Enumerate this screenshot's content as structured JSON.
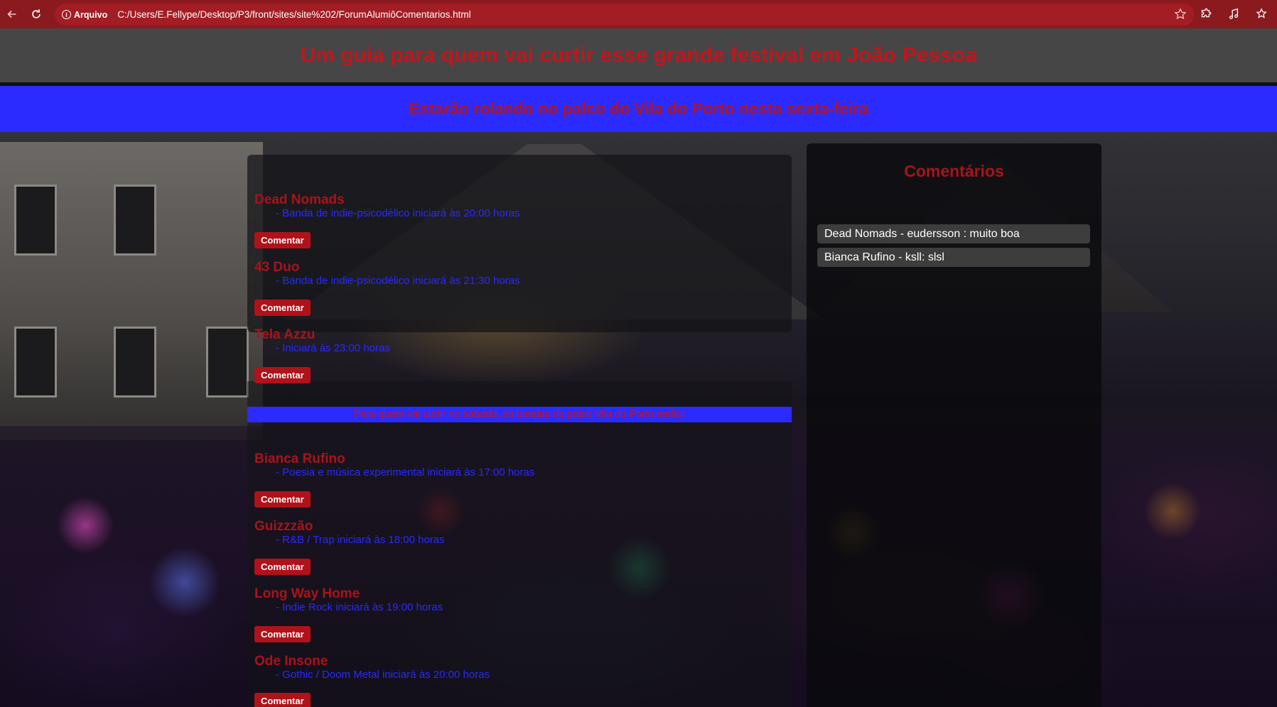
{
  "browser": {
    "info_label": "Arquivo",
    "url": "C:/Users/E.Fellype/Desktop/P3/front/sites/site%202/ForumAlumiôComentarios.html"
  },
  "page": {
    "title": "Um guia para quem vai curtir esse grande festival em João Pessoa",
    "friday_heading": "Estarão rolando no palco do Vila do Porto nesta sexta-feira",
    "saturday_heading": "Para quem vai curtir no sábado, as bandas do palco Vila do Porto serão:",
    "comment_button_label": "Comentar"
  },
  "friday_bands": [
    {
      "name": "Dead Nomads",
      "desc": "Banda de indie-psicodélico iniciará às 20:00 horas"
    },
    {
      "name": "43 Duo",
      "desc": "Banda de indie-psicodélico iniciará às 21:30 horas"
    },
    {
      "name": "Tela Azzu",
      "desc": "Iniciará às 23:00 horas"
    }
  ],
  "saturday_bands": [
    {
      "name": "Bianca Rufino",
      "desc": "Poesia e música experimental iniciará às 17:00 horas"
    },
    {
      "name": "Guizzzão",
      "desc": "R&B / Trap iniciará às 18:00 horas"
    },
    {
      "name": "Long Way Home",
      "desc": "Indie Rock iniciará às 19:00 horas"
    },
    {
      "name": "Ode Insone",
      "desc": "Gothic / Doom Metal iniciará às 20:00 horas"
    }
  ],
  "comments": {
    "title": "Comentários",
    "items": [
      "Dead Nomads - eudersson : muito boa",
      "Bianca Rufino - ksll: slsl"
    ]
  },
  "colors": {
    "chrome": "#8b1a1f",
    "header_text": "#c0161d",
    "banner_bg": "#2b2bff",
    "button_bg": "#b0121a",
    "desc_text": "#2a2aff"
  }
}
